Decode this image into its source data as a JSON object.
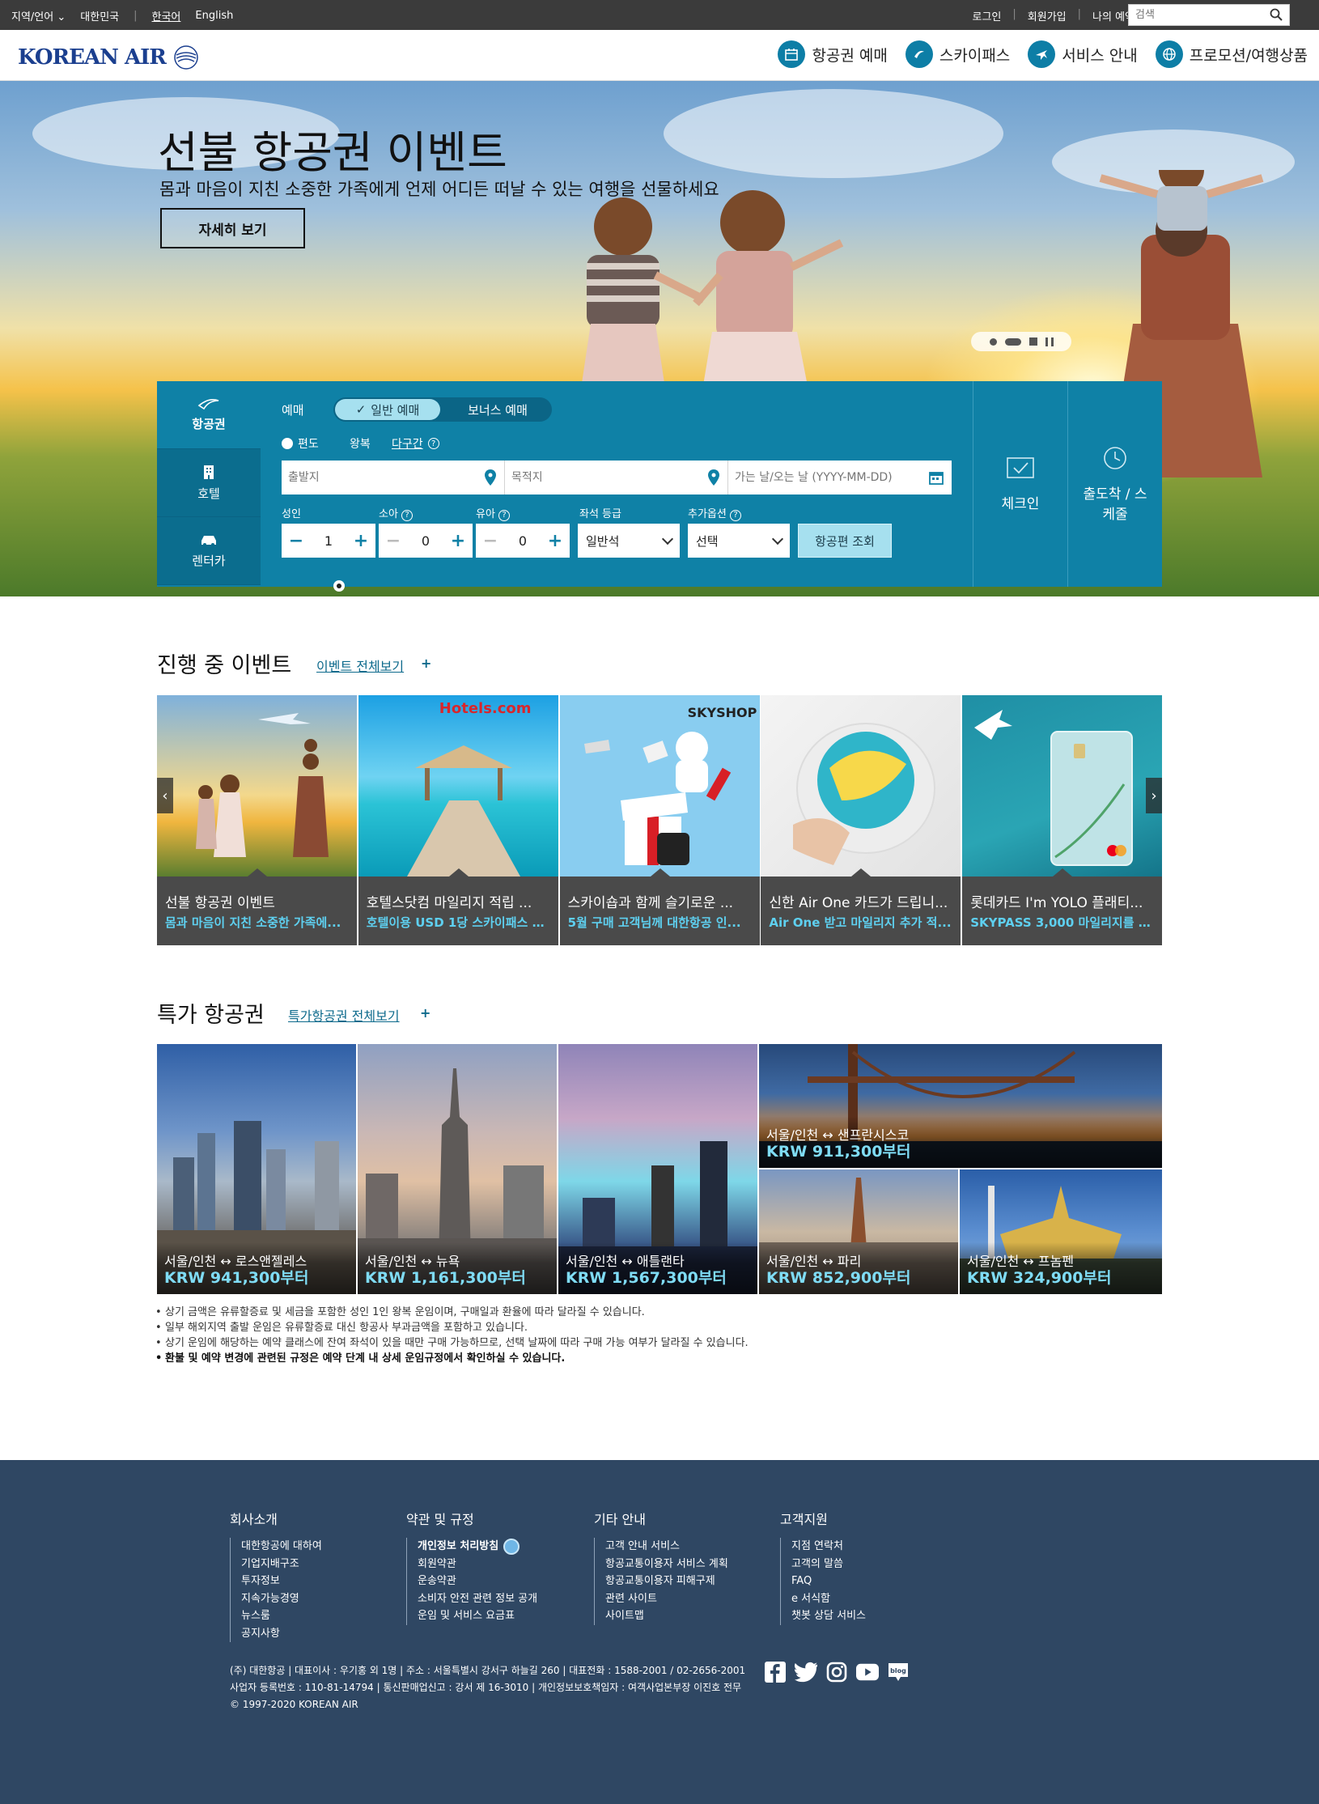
{
  "utility": {
    "region_label": "지역/언어",
    "country": "대한민국",
    "lang_ko": "한국어",
    "lang_en": "English",
    "login": "로그인",
    "signup": "회원가입",
    "mypage": "나의 예약",
    "search_placeholder": "검색"
  },
  "header": {
    "logo_text": "KOREAN AIR",
    "nav": [
      {
        "label": "항공권 예매",
        "icon": "calendar-icon"
      },
      {
        "label": "스카이패스",
        "icon": "skypass-icon"
      },
      {
        "label": "서비스 안내",
        "icon": "plane-icon"
      },
      {
        "label": "프로모션/여행상품",
        "icon": "globe-icon"
      }
    ]
  },
  "hero": {
    "title": "선불 항공권 이벤트",
    "subtitle": "몸과 마음이 지친 소중한 가족에게 언제 어디든 떠날 수 있는 여행을 선물하세요",
    "button": "자세히 보기"
  },
  "booking": {
    "tabs": [
      {
        "label": "항공권",
        "icon": "airline-icon"
      },
      {
        "label": "호텔",
        "icon": "hotel-icon"
      },
      {
        "label": "렌터카",
        "icon": "car-icon"
      }
    ],
    "booking_label": "예매",
    "type_normal": "일반 예매",
    "type_bonus": "보너스 예매",
    "trip_oneway": "편도",
    "trip_round": "왕복",
    "trip_multi": "다구간",
    "from_placeholder": "출발지",
    "to_placeholder": "목적지",
    "date_placeholder": "가는 날/오는 날 (YYYY-MM-DD)",
    "adult_label": "성인",
    "child_label": "소아",
    "infant_label": "유아",
    "class_label": "좌석 등급",
    "option_label": "추가옵션",
    "adult_value": "1",
    "child_value": "0",
    "infant_value": "0",
    "class_value": "일반석",
    "option_value": "선택",
    "search_button": "항공편 조회",
    "checkin": "체크인",
    "schedule": "출도착 / 스케줄"
  },
  "events": {
    "title": "진행 중 이벤트",
    "link": "이벤트 전체보기",
    "plus": "+",
    "items": [
      {
        "title": "선불 항공권 이벤트",
        "desc": "몸과 마음이 지친 소중한 가족에..."
      },
      {
        "title": "호텔스닷컴 마일리지 적립 ...",
        "desc": "호텔이용 USD 1당 스카이패스 1 ...",
        "brand": "Hotels.com"
      },
      {
        "title": "스카이숍과 함께 슬기로운 ...",
        "desc": "5월 구매 고객님께 대한항공 인...",
        "brand": "SKYSHOP"
      },
      {
        "title": "신한 Air One 카드가 드립니...",
        "desc": "Air One 받고 마일리지 추가 적..."
      },
      {
        "title": "롯데카드 I'm YOLO 플래티...",
        "desc": "SKYPASS 3,000 마일리지를 드..."
      }
    ]
  },
  "deals": {
    "title": "특가 항공권",
    "link": "특가항공권 전체보기",
    "plus": "+",
    "items": [
      {
        "route": "서울/인천 ↔ 로스앤젤레스",
        "price": "KRW 941,300부터"
      },
      {
        "route": "서울/인천 ↔ 뉴욕",
        "price": "KRW 1,161,300부터"
      },
      {
        "route": "서울/인천 ↔ 애틀랜타",
        "price": "KRW 1,567,300부터"
      },
      {
        "route": "서울/인천 ↔ 샌프란시스코",
        "price": "KRW 911,300부터"
      },
      {
        "route": "서울/인천 ↔ 파리",
        "price": "KRW 852,900부터"
      },
      {
        "route": "서울/인천 ↔ 프놈펜",
        "price": "KRW 324,900부터"
      }
    ],
    "notes": [
      "상기 금액은 유류할증료 및 세금을 포함한 성인 1인 왕복 운임이며, 구매일과 환율에 따라 달라질 수 있습니다.",
      "일부 해외지역 출발 운임은 유류할증료 대신 항공사 부과금액을 포함하고 있습니다.",
      "상기 운임에 해당하는 예약 클래스에 잔여 좌석이 있을 때만 구매 가능하므로, 선택 날짜에 따라 구매 가능 여부가 달라질 수 있습니다.",
      "환불 및 예약 변경에 관련된 규정은 예약 단계 내 상세 운임규정에서 확인하실 수 있습니다."
    ]
  },
  "footer": {
    "cols": [
      {
        "title": "회사소개",
        "items": [
          "대한항공에 대하여",
          "기업지배구조",
          "투자정보",
          "지속가능경영",
          "뉴스룸",
          "공지사항"
        ]
      },
      {
        "title": "약관 및 규정",
        "items": [
          "개인정보 처리방침",
          "회원약관",
          "운송약관",
          "소비자 안전 관련 정보 공개",
          "운임 및 서비스 요금표"
        ]
      },
      {
        "title": "기타 안내",
        "items": [
          "고객 안내 서비스",
          "항공교통이용자 서비스 계획",
          "항공교통이용자 피해구제",
          "관련 사이트",
          "사이트맵"
        ]
      },
      {
        "title": "고객지원",
        "items": [
          "지점 연락처",
          "고객의 말씀",
          "FAQ",
          "e 서식함",
          "챗봇 상담 서비스"
        ]
      }
    ],
    "info1": "(주) 대한항공 | 대표이사 : 우기홍 외 1명 | 주소 : 서울특별시 강서구 하늘길 260 | 대표전화 : 1588-2001 / 02-2656-2001",
    "info2": "사업자 등록번호 : 110-81-14794 | 통신판매업신고 : 강서 제 16-3010 | 개인정보보호책임자 : 여객사업본부장 이진호 전무",
    "copyright": "© 1997-2020 KOREAN AIR",
    "social": [
      "facebook-icon",
      "twitter-icon",
      "instagram-icon",
      "youtube-icon",
      "blog-icon"
    ],
    "social_blog_text": "blog"
  },
  "colors": {
    "brand_blue": "#0f81a6",
    "accent_cyan": "#5ed0f0",
    "footer_bg": "#2f4763",
    "util_bg": "#3b3b3b"
  }
}
